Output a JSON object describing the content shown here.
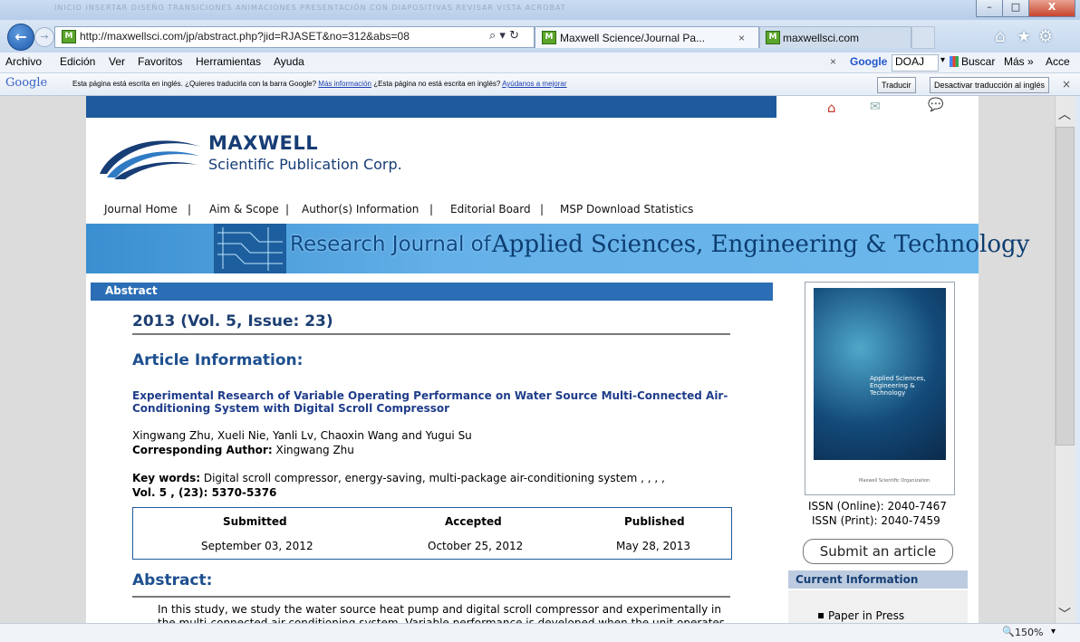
{
  "window": {
    "ribbon_ghost": "INICIO   INSERTAR   DISEÑO   TRANSICIONES   ANIMACIONES   PRESENTACIÓN CON DIAPOSITIVAS   REVISAR   VISTA   ACROBAT",
    "minimize": "–",
    "maximize": "□",
    "close": "X"
  },
  "nav": {
    "back": "←",
    "forward": "→",
    "url": "http://maxwellsci.com/jp/abstract.php?jid=RJASET&no=312&abs=08",
    "search_refresh": "⌕ ▾ ↻",
    "tabs": [
      {
        "label": "Maxwell Science/Journal Pa...",
        "close": "×"
      },
      {
        "label": "maxwellsci.com"
      }
    ],
    "home": "⌂",
    "star": "★",
    "gear": "⚙"
  },
  "menu": {
    "items": [
      "Archivo",
      "Edición",
      "Ver",
      "Favoritos",
      "Herramientas",
      "Ayuda"
    ],
    "close_x": "×",
    "google_label": "Google",
    "doaj": "DOAJ",
    "buscar": "Buscar",
    "mas": "Más »",
    "acce": "Acce"
  },
  "google_bar": {
    "logo": "Google",
    "message": "Esta página está escrita en inglés. ¿Quieres traducirla con la barra Google?",
    "more_info": "Más información",
    "not_english": "¿Esta página no está escrita en inglés?",
    "help": "Ayúdanos a mejorar",
    "translate_btn": "Traducir",
    "disable_btn": "Desactivar traducción al inglés",
    "close": "×"
  },
  "site": {
    "brand_name": "MAXWELL",
    "brand_sub": "Scientific Publication Corp.",
    "nav_items": [
      "Journal Home",
      "Aim & Scope",
      "Author(s) Information",
      "Editorial Board",
      "MSP Download Statistics"
    ],
    "nav_sep": "|",
    "banner_a": "Research Journal of",
    "banner_b": "Applied Sciences, Engineering & Technology"
  },
  "article": {
    "section_head": "Abstract",
    "volume": "2013 (Vol. 5, Issue: 23)",
    "info_heading": "Article Information:",
    "title": "Experimental Research of Variable Operating Performance on Water Source Multi-Connected Air-Conditioning System with Digital Scroll Compressor",
    "authors": "Xingwang Zhu, Xueli Nie, Yanli Lv, Chaoxin Wang and Yugui Su",
    "corr_label": "Corresponding Author:",
    "corr_name": "Xingwang Zhu",
    "kw_label": "Key words:",
    "keywords": "Digital scroll compressor, energy-saving, multi-package air-conditioning system , , , ,",
    "vol_pages": "Vol. 5 , (23): 5370-5376",
    "dates": {
      "submitted_label": "Submitted",
      "accepted_label": "Accepted",
      "published_label": "Published",
      "submitted": "September 03, 2012",
      "accepted": "October 25, 2012",
      "published": "May 28, 2013"
    },
    "abstract_heading": "Abstract:",
    "abstract_line1": "In this study, we study the water source heat pump and digital scroll compressor and experimentally in",
    "abstract_line2": "the multi-connected air-conditioning system. Variable performance is developed when the unit operates"
  },
  "sidebar": {
    "cover_title": "Applied Sciences, Engineering & Technology",
    "cover_footer": "Maxwell Scientific Organization",
    "issn_online": "ISSN (Online):  2040-7467",
    "issn_print": "ISSN (Print):  2040-7459",
    "submit": "Submit an article",
    "current_info": "Current Information",
    "paper_in_press": "Paper in Press"
  },
  "status": {
    "zoom": "150%"
  }
}
